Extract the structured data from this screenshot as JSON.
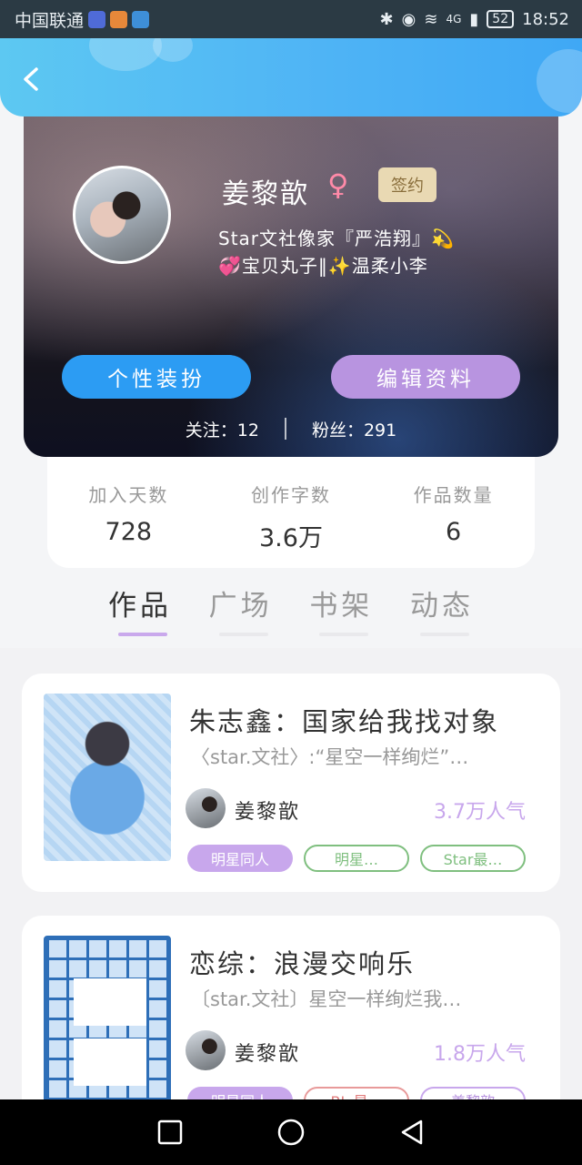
{
  "status_bar": {
    "carrier": "中国联通",
    "network": "4G",
    "battery": "52",
    "time": "18:52"
  },
  "header": {
    "back_icon": "chevron-left-icon"
  },
  "profile": {
    "name": "姜黎歆",
    "gender_symbol": "♀",
    "signed_badge": "签约",
    "bio_line1": "Star文社像家『严浩翔』💫",
    "bio_line2": "💞宝贝丸子‖✨温柔小李",
    "decorate_button": "个性装扮",
    "edit_button": "编辑资料",
    "following_label": "关注：12",
    "followers_label": "粉丝：291"
  },
  "stats": [
    {
      "label": "加入天数",
      "value": "728"
    },
    {
      "label": "创作字数",
      "value": "3.6万"
    },
    {
      "label": "作品数量",
      "value": "6"
    }
  ],
  "tabs": [
    {
      "label": "作品",
      "active": true
    },
    {
      "label": "广场",
      "active": false
    },
    {
      "label": "书架",
      "active": false
    },
    {
      "label": "动态",
      "active": false
    }
  ],
  "works": [
    {
      "title": "朱志鑫：国家给我找对象",
      "desc": "〈star.文社〉:“星空一样绚烂”…",
      "author": "姜黎歆",
      "popularity": "3.7万人气",
      "tags": [
        "明星同人",
        "明星…",
        "Star最…"
      ]
    },
    {
      "title": "恋综：浪漫交响乐",
      "desc": "〔star.文社〕星空一样绚烂我…",
      "author": "姜黎歆",
      "popularity": "1.8万人气",
      "tags": [
        "明星同人",
        "BL 星…",
        "姜黎歆"
      ]
    }
  ],
  "colors": {
    "header_blue": "#4fb4f5",
    "decor_button": "#2c9cf3",
    "edit_button": "#b894e0",
    "accent_purple": "#c8a7ec"
  }
}
